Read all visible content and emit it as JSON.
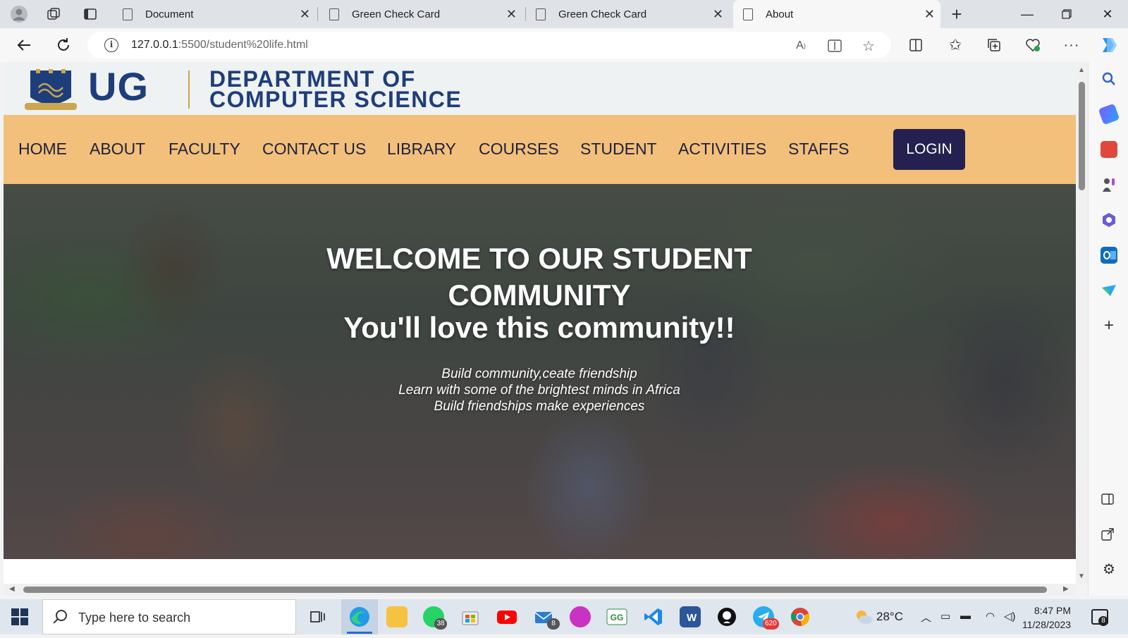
{
  "browser": {
    "tabs": [
      {
        "title": "Document",
        "active": false
      },
      {
        "title": "Green Check Card",
        "active": false
      },
      {
        "title": "Green Check Card",
        "active": false
      },
      {
        "title": "About",
        "active": true
      }
    ],
    "url_host": "127.0.0.1",
    "url_rest": ":5500/student%20life.html"
  },
  "site": {
    "logo_text": "UG",
    "dept_line1": "DEPARTMENT OF",
    "dept_line2": "COMPUTER SCIENCE",
    "nav": [
      "HOME",
      "ABOUT",
      "FACULTY",
      "CONTACT US",
      "LIBRARY",
      "COURSES",
      "STUDENT",
      "ACTIVITIES",
      "STAFFS"
    ],
    "login_label": "LOGIN",
    "accent_nav_color": "#f2c07a",
    "accent_brand_color": "#1e3d7b",
    "login_color": "#242150"
  },
  "hero": {
    "title": "WELCOME TO OUR STUDENT COMMUNITY",
    "subtitle": "You'll love this community!!",
    "lines": [
      "Build community,ceate friendship",
      "Learn with some of the brightest minds in Africa",
      "Build friendships make experiences"
    ]
  },
  "taskbar": {
    "search_placeholder": "Type here to search",
    "whatsapp_badge": "38",
    "mail_badge": "8",
    "telegram_badge": "620",
    "temperature": "28°C",
    "time": "8:47 PM",
    "date": "11/28/2023",
    "notifications": "8"
  }
}
